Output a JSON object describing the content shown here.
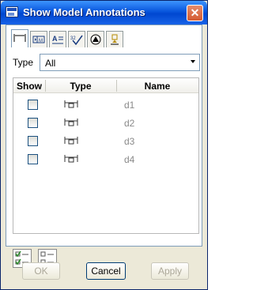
{
  "window": {
    "title": "Show Model Annotations",
    "close_glyph": "✕"
  },
  "tabs": [
    {
      "icon": "dimension-tab-icon",
      "active": true
    },
    {
      "icon": "geometric-tolerance-tab-icon",
      "active": false
    },
    {
      "icon": "note-tab-icon",
      "active": false
    },
    {
      "icon": "surface-finish-tab-icon",
      "active": false
    },
    {
      "icon": "symbol-tab-icon",
      "active": false
    },
    {
      "icon": "datum-tab-icon",
      "active": false
    }
  ],
  "type_filter": {
    "label": "Type",
    "value": "All"
  },
  "table": {
    "headers": {
      "show": "Show",
      "type": "Type",
      "name": "Name"
    },
    "rows": [
      {
        "name": "d1",
        "checked": false,
        "type_icon": "dimension-icon"
      },
      {
        "name": "d2",
        "checked": false,
        "type_icon": "dimension-icon"
      },
      {
        "name": "d3",
        "checked": false,
        "type_icon": "dimension-icon"
      },
      {
        "name": "d4",
        "checked": false,
        "type_icon": "dimension-icon"
      }
    ]
  },
  "actions": {
    "select_all_icon": "select-all-icon",
    "deselect_all_icon": "deselect-all-icon"
  },
  "buttons": {
    "ok": {
      "label": "OK",
      "enabled": false
    },
    "cancel": {
      "label": "Cancel",
      "enabled": true
    },
    "apply": {
      "label": "Apply",
      "enabled": false
    }
  },
  "colors": {
    "titlebar": "#0856dc",
    "close_button": "#d55a30",
    "dialog_bg": "#ece9d8"
  }
}
